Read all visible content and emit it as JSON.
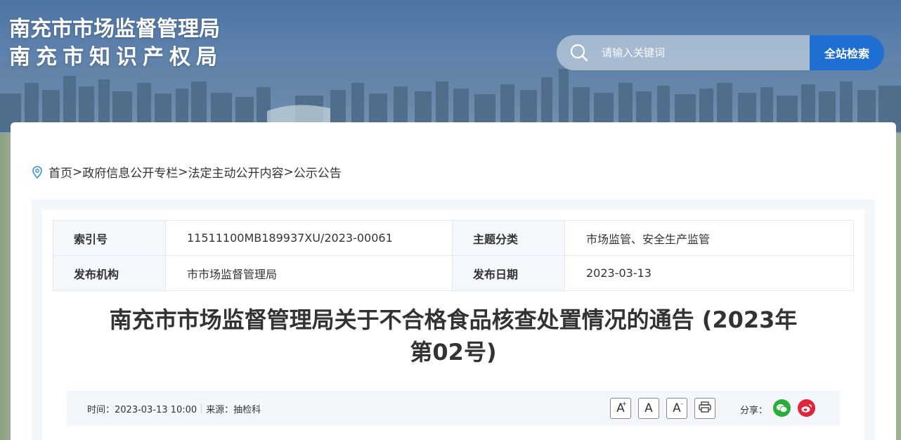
{
  "header": {
    "logo_line1": "南充市市场监督管理局",
    "logo_line2": "南充市知识产权局",
    "search_placeholder": "请输入关键词",
    "search_button": "全站检索"
  },
  "breadcrumb": [
    {
      "label": "首页"
    },
    {
      "label": "政府信息公开专栏"
    },
    {
      "label": "法定主动公开内容"
    },
    {
      "label": "公示公告"
    }
  ],
  "breadcrumb_sep": ">",
  "meta": {
    "index_label": "索引号",
    "index_value": "11511100MB189937XU/2023-00061",
    "category_label": "主题分类",
    "category_value": "市场监管、安全生产监管",
    "publisher_label": "发布机构",
    "publisher_value": "市市场监督管理局",
    "date_label": "发布日期",
    "date_value": "2023-03-13"
  },
  "article": {
    "title_line1": "南充市市场监督管理局关于不合格食品核查处置情况的通告 (2023年",
    "title_line2": "第02号)",
    "time_text": "时间：2023-03-13 10:00",
    "source_text": "来源：抽检科",
    "share_label": "分享："
  },
  "tools": {
    "font_larger": "A",
    "font_normal": "A",
    "font_smaller": "A"
  },
  "colors": {
    "accent": "#1f6fd2",
    "wechat": "#2bad3a",
    "weibo": "#e0243a"
  }
}
